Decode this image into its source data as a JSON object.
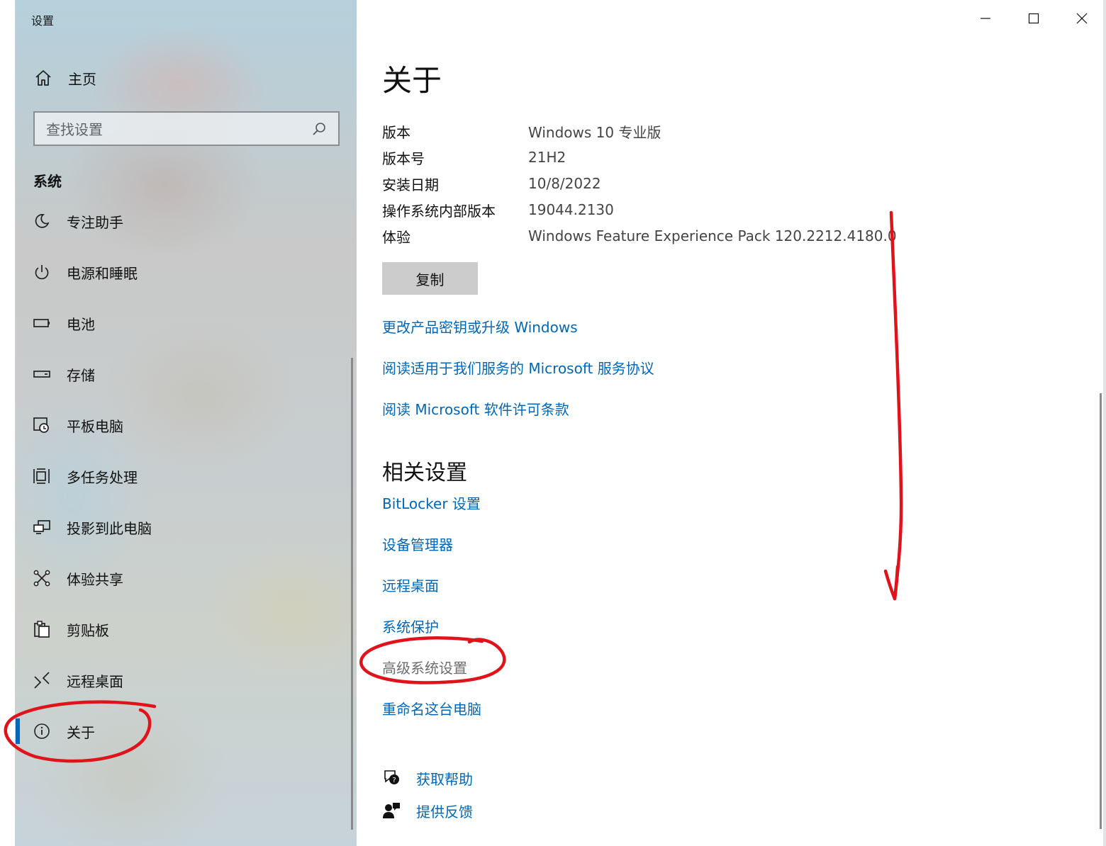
{
  "window": {
    "title": "设置",
    "controls": {
      "minimize": "minimize-icon",
      "maximize": "maximize-icon",
      "close": "close-icon"
    }
  },
  "sidebar": {
    "home_label": "主页",
    "search_placeholder": "查找设置",
    "section_title": "系统",
    "items": [
      {
        "label": "专注助手",
        "icon": "moon-icon"
      },
      {
        "label": "电源和睡眠",
        "icon": "power-icon"
      },
      {
        "label": "电池",
        "icon": "battery-icon"
      },
      {
        "label": "存储",
        "icon": "storage-icon"
      },
      {
        "label": "平板电脑",
        "icon": "tablet-icon"
      },
      {
        "label": "多任务处理",
        "icon": "multitasking-icon"
      },
      {
        "label": "投影到此电脑",
        "icon": "project-icon"
      },
      {
        "label": "体验共享",
        "icon": "share-icon"
      },
      {
        "label": "剪贴板",
        "icon": "clipboard-icon"
      },
      {
        "label": "远程桌面",
        "icon": "remote-desktop-icon"
      },
      {
        "label": "关于",
        "icon": "info-icon",
        "active": true
      }
    ]
  },
  "main": {
    "title": "关于",
    "specs": [
      {
        "key": "版本",
        "value": "Windows 10 专业版"
      },
      {
        "key": "版本号",
        "value": "21H2"
      },
      {
        "key": "安装日期",
        "value": "10/8/2022"
      },
      {
        "key": "操作系统内部版本",
        "value": "19044.2130"
      },
      {
        "key": "体验",
        "value": "Windows Feature Experience Pack 120.2212.4180.0"
      }
    ],
    "copy_button": "复制",
    "links": [
      "更改产品密钥或升级 Windows",
      "阅读适用于我们服务的 Microsoft 服务协议",
      "阅读 Microsoft 软件许可条款"
    ],
    "related_title": "相关设置",
    "related_links": [
      "BitLocker 设置",
      "设备管理器",
      "远程桌面",
      "系统保护",
      "高级系统设置",
      "重命名这台电脑"
    ],
    "help": [
      {
        "label": "获取帮助",
        "icon": "help-chat-icon"
      },
      {
        "label": "提供反馈",
        "icon": "feedback-icon"
      }
    ]
  },
  "colors": {
    "accent": "#0067c0",
    "link": "#0067b8",
    "annotation": "#e0131a"
  }
}
